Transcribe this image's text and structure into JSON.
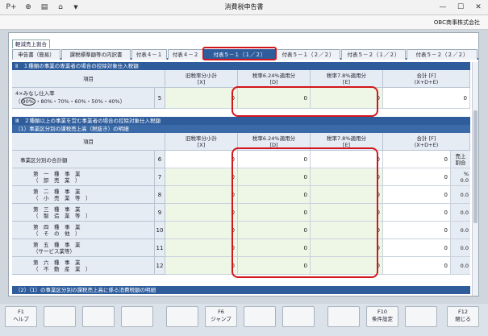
{
  "window": {
    "title": "消費税申告書"
  },
  "toolbar": {
    "icons": [
      "add-record-icon",
      "search-zoom-icon",
      "print-icon",
      "home-icon",
      "dropdown-icon"
    ]
  },
  "corp": {
    "name": "OBC商事株式会社"
  },
  "subtab": "軽減売上割合",
  "tabs": [
    {
      "label": "申告書（簡易）",
      "active": false
    },
    {
      "label": "課税標準額等の内訳書",
      "active": false
    },
    {
      "label": "付表４－１",
      "active": false
    },
    {
      "label": "付表４－２",
      "active": false
    },
    {
      "label": "付表５－１（１／２）",
      "active": true
    },
    {
      "label": "付表５－１（２／２）",
      "active": false
    },
    {
      "label": "付表５－２（１／２）",
      "active": false
    },
    {
      "label": "付表５－２（２／２）",
      "active": false
    }
  ],
  "section2": {
    "title": "Ⅱ　１種類の事業の専業者の場合の控除対象仕入税額",
    "headers": {
      "item": "項目",
      "old": "旧税率分小計",
      "old_code": "[X]",
      "d": "税率6.24%適用分",
      "d_code": "[D]",
      "e": "税率7.8%適用分",
      "e_code": "[E]",
      "total": "合計 [F]",
      "total_code": "(X+D+E)"
    },
    "row": {
      "label1": "4×みなし仕入率",
      "rates_open": "（",
      "rate_selected": "90%",
      "rates_rest": "・80%・70%・60%・50%・40%）",
      "no": "5",
      "x": "0",
      "d": "0",
      "e": "0",
      "f": "0"
    }
  },
  "section3": {
    "title": "Ⅲ　２種類以上の事業を営む事業者の場合の控除対象仕入税額",
    "subtitle": "（1）事業区分別の課税売上高（税抜き）の明細",
    "headers": {
      "item": "項目",
      "old": "旧税率分小計",
      "old_code": "[X]",
      "d": "税率6.24%適用分",
      "d_code": "[D]",
      "e": "税率7.8%適用分",
      "e_code": "[E]",
      "total": "合計 [F]",
      "total_code": "(X+D+E)",
      "ratio": "売上割合"
    },
    "rows": [
      {
        "l1": "事業区分別の合計額",
        "l2": "",
        "no": "6",
        "x": "0",
        "d": "0",
        "e": "0",
        "f": "0",
        "p1": "売上",
        "p2": "割合"
      },
      {
        "l1": "第　一　種　事　業",
        "l2": "（　卸　売　業　）",
        "no": "7",
        "x": "0",
        "d": "0",
        "e": "0",
        "f": "0",
        "p1": "%",
        "p2": "0.0"
      },
      {
        "l1": "第　二　種　事　業",
        "l2": "（　小　売　業　等　）",
        "no": "8",
        "x": "0",
        "d": "0",
        "e": "0",
        "f": "0",
        "p1": "",
        "p2": "0.0"
      },
      {
        "l1": "第　三　種　事　業",
        "l2": "（　製　造　業　等　）",
        "no": "9",
        "x": "0",
        "d": "0",
        "e": "0",
        "f": "0",
        "p1": "",
        "p2": "0.0"
      },
      {
        "l1": "第　四　種　事　業",
        "l2": "（　そ　の　他　）",
        "no": "10",
        "x": "0",
        "d": "0",
        "e": "0",
        "f": "0",
        "p1": "",
        "p2": "0.0"
      },
      {
        "l1": "第　五　種　事　業",
        "l2": "（サービス業等）",
        "no": "11",
        "x": "0",
        "d": "0",
        "e": "0",
        "f": "0",
        "p1": "",
        "p2": "0.0"
      },
      {
        "l1": "第　六　種　事　業",
        "l2": "（　不　動　産　業　）",
        "no": "12",
        "x": "0",
        "d": "0",
        "e": "0",
        "f": "0",
        "p1": "",
        "p2": "0.0"
      }
    ],
    "next": "（2）（1）の事業区分別の課税売上高に係る消費税額の明細"
  },
  "fkeys": [
    {
      "key": "F1",
      "label": "ヘルプ"
    },
    {
      "key": "",
      "label": ""
    },
    {
      "key": "",
      "label": ""
    },
    {
      "key": "",
      "label": ""
    },
    {
      "key": "",
      "label": ""
    },
    {
      "key": "F6",
      "label": "ジャンプ"
    },
    {
      "key": "",
      "label": ""
    },
    {
      "key": "",
      "label": ""
    },
    {
      "key": "",
      "label": ""
    },
    {
      "key": "F10",
      "label": "条件設定"
    },
    {
      "key": "",
      "label": ""
    },
    {
      "key": "F12",
      "label": "閉じる"
    }
  ]
}
